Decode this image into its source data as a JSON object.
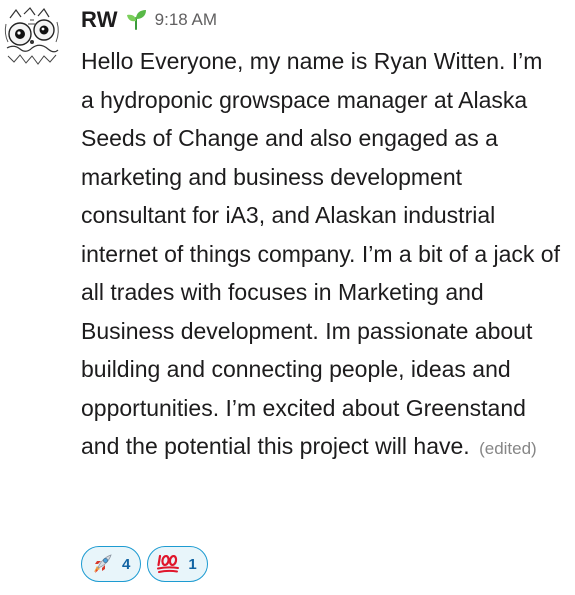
{
  "message": {
    "sender": "RW",
    "status_icon": "seedling-icon",
    "timestamp": "9:18 AM",
    "text": "Hello Everyone, my name is Ryan Witten. I’m a hydroponic growspace manager at Alaska Seeds of Change and also engaged as a marketing and business development consultant for iA3, and Alaskan industrial internet of things company. I’m a bit of a jack of all trades with focuses in Marketing and Business development. Im passionate about building and connecting people, ideas and opportunities. I’m excited about Greenstand and the potential this project will have.",
    "edited_label": "(edited)"
  },
  "reactions": [
    {
      "emoji": "rocket-icon",
      "count": "4"
    },
    {
      "emoji": "hundred-points-icon",
      "count": "1"
    }
  ],
  "colors": {
    "reaction_border": "#1d9bd1",
    "reaction_bg": "#e8f5fa",
    "reaction_count": "#1264a3",
    "timestamp": "#616061"
  }
}
